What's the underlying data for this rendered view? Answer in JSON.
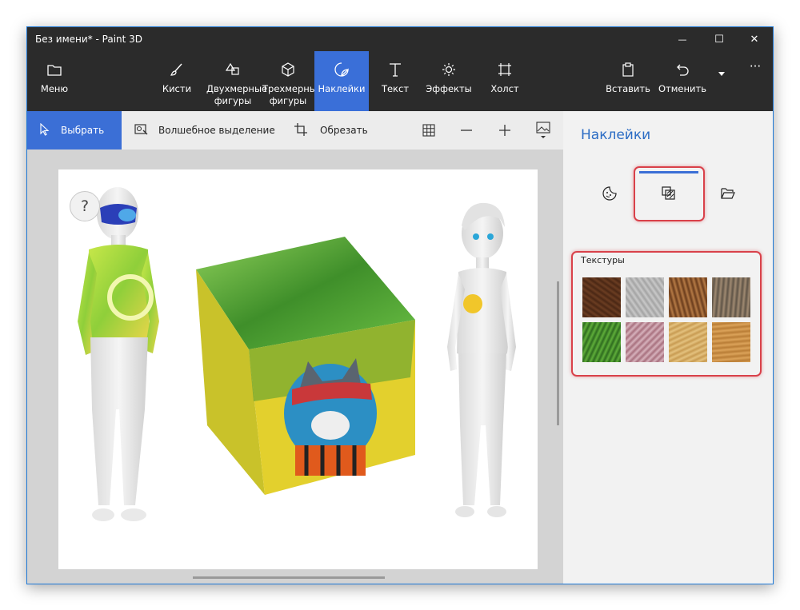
{
  "window": {
    "title": "Без имени* - Paint 3D",
    "close_glyph": "✕",
    "minimize_glyph": "—",
    "maximize_glyph": "☐"
  },
  "ribbon": {
    "menu": {
      "label": "Меню",
      "icon": "folder-icon"
    },
    "tools": [
      {
        "label": "Кисти",
        "icon": "brush-icon"
      },
      {
        "label": "Двухмерные фигуры",
        "icon": "shapes-2d-icon"
      },
      {
        "label": "Трехмерные фигуры",
        "icon": "cube-3d-icon"
      },
      {
        "label": "Наклейки",
        "icon": "stickers-icon",
        "active": true
      },
      {
        "label": "Текст",
        "icon": "text-icon"
      },
      {
        "label": "Эффекты",
        "icon": "effects-icon"
      },
      {
        "label": "Холст",
        "icon": "canvas-icon"
      }
    ],
    "paste": "Вставить",
    "undo": "Отменить",
    "more_glyph": "···"
  },
  "toolbar": {
    "select": "Выбрать",
    "magic_select": "Волшебное выделение",
    "crop": "Обрезать",
    "icons": [
      "grid-icon",
      "zoom-out-icon",
      "zoom-in-icon",
      "view-image-icon"
    ]
  },
  "canvas": {
    "help_glyph": "?"
  },
  "panel": {
    "title": "Наклейки",
    "tabs": [
      "stickers-smiley-icon",
      "textures-icon",
      "custom-folder-icon"
    ],
    "active_tab": "textures",
    "section_label": "Текстуры",
    "textures": [
      {
        "name": "bark",
        "c1": "#6b3d22",
        "c2": "#4a2714"
      },
      {
        "name": "stone",
        "c1": "#c9c9c9",
        "c2": "#a3a3a3"
      },
      {
        "name": "hair",
        "c1": "#b57a45",
        "c2": "#6a3c1c"
      },
      {
        "name": "pebbles",
        "c1": "#a08a72",
        "c2": "#5f5447"
      },
      {
        "name": "leaves",
        "c1": "#5fae3a",
        "c2": "#2e6b1f"
      },
      {
        "name": "marble-pink",
        "c1": "#d7b3bd",
        "c2": "#a8707e"
      },
      {
        "name": "sand",
        "c1": "#e4c27f",
        "c2": "#c89b52"
      },
      {
        "name": "wood",
        "c1": "#dca35a",
        "c2": "#b97d36"
      }
    ]
  },
  "colors": {
    "accent": "#3b6fd6",
    "highlight": "#d9414a",
    "panel_title": "#2b6cc4"
  }
}
